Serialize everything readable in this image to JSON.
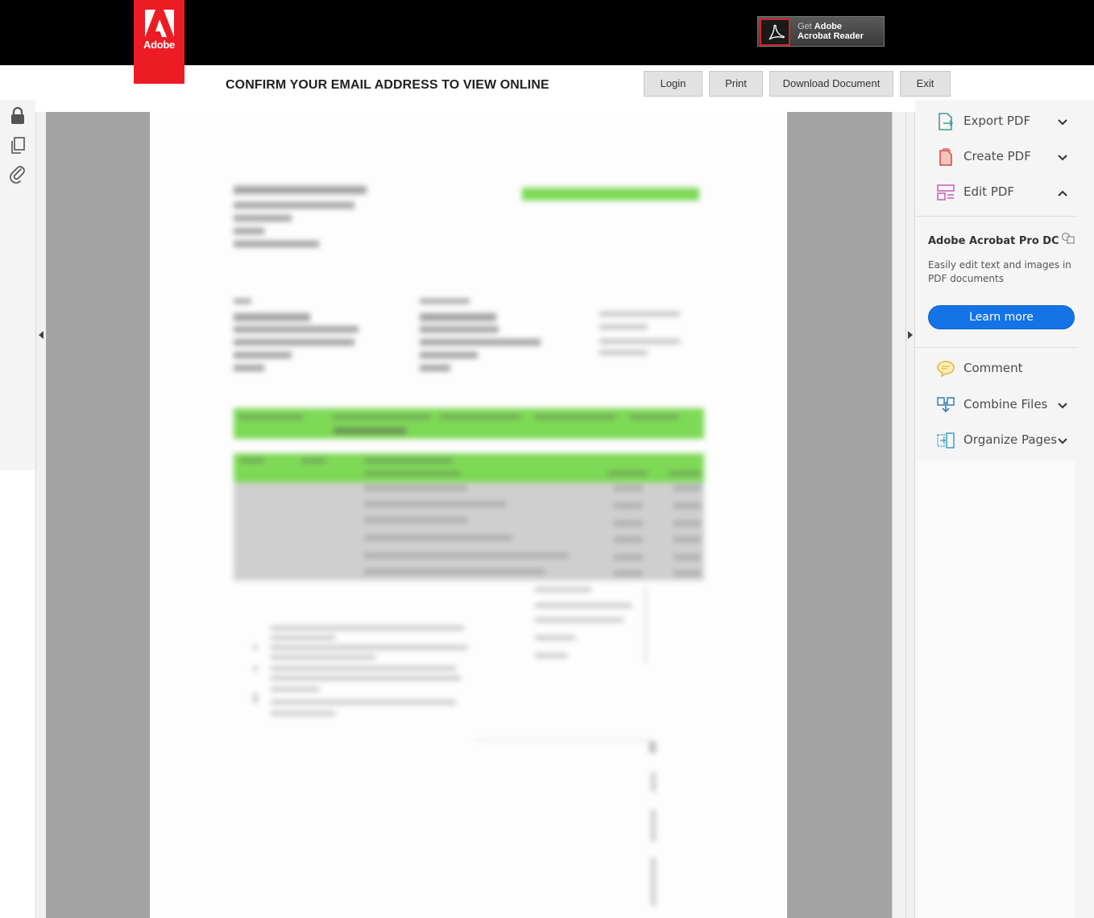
{
  "header": {
    "logo_text": "Adobe",
    "get_reader": {
      "line1_prefix": "Get ",
      "line1_brand": "Adobe",
      "line2": "Acrobat Reader"
    },
    "confirm_title": "CONFIRM YOUR EMAIL ADDRESS TO VIEW ONLINE",
    "buttons": {
      "login": "Login",
      "print": "Print",
      "download": "Download Document",
      "exit": "Exit"
    }
  },
  "left_toolbar": {
    "icons": [
      "lock-icon",
      "copy-pages-icon",
      "paperclip-icon"
    ]
  },
  "document": {
    "heading_color": "#7ed957",
    "accent_color": "#7ed957"
  },
  "tools_pane": {
    "tools_top": [
      {
        "label": "Export PDF",
        "icon": "export-pdf-icon",
        "chevron": "down"
      },
      {
        "label": "Create PDF",
        "icon": "create-pdf-icon",
        "chevron": "down"
      },
      {
        "label": "Edit PDF",
        "icon": "edit-pdf-icon",
        "chevron": "up"
      }
    ],
    "promo": {
      "title": "Adobe Acrobat Pro DC",
      "description": "Easily edit text and images in PDF documents",
      "button": "Learn more",
      "button_color": "#1473e6"
    },
    "tools_bottom": [
      {
        "label": "Comment",
        "icon": "comment-icon",
        "chevron": ""
      },
      {
        "label": "Combine Files",
        "icon": "combine-files-icon",
        "chevron": "down"
      },
      {
        "label": "Organize Pages",
        "icon": "organize-pages-icon",
        "chevron": "down"
      }
    ]
  },
  "colors": {
    "adobe_red": "#ed1c24",
    "topbar": "#000000",
    "viewer_gray": "#a3a3a3"
  }
}
